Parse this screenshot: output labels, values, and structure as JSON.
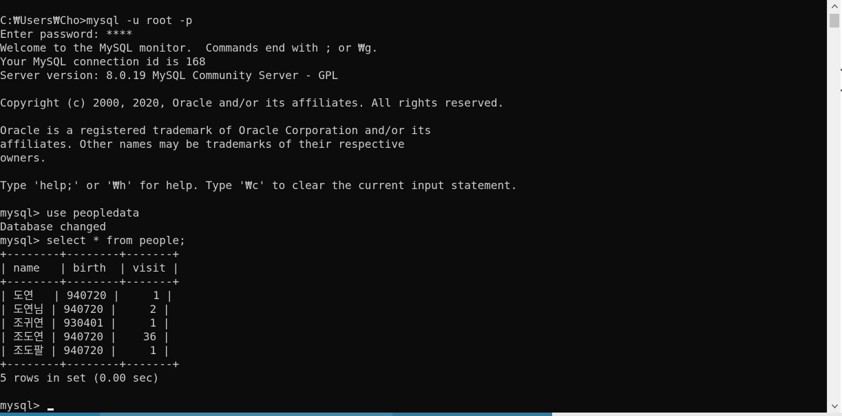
{
  "terminal": {
    "lines": [
      "C:₩Users₩Cho>mysql -u root -p",
      "Enter password: ****",
      "Welcome to the MySQL monitor.  Commands end with ; or ₩g.",
      "Your MySQL connection id is 168",
      "Server version: 8.0.19 MySQL Community Server - GPL",
      "",
      "Copyright (c) 2000, 2020, Oracle and/or its affiliates. All rights reserved.",
      "",
      "Oracle is a registered trademark of Oracle Corporation and/or its",
      "affiliates. Other names may be trademarks of their respective",
      "owners.",
      "",
      "Type 'help;' or '₩h' for help. Type '₩c' to clear the current input statement.",
      "",
      "mysql> use peopledata",
      "Database changed",
      "mysql> select * from people;",
      "+--------+--------+-------+",
      "| name   | birth  | visit |",
      "+--------+--------+-------+",
      "| 도연   | 940720 |     1 |",
      "| 도연님 | 940720 |     2 |",
      "| 조귀연 | 930401 |     1 |",
      "| 조도연 | 940720 |    36 |",
      "| 조도팔 | 940720 |     1 |",
      "+--------+--------+-------+",
      "5 rows in set (0.00 sec)",
      ""
    ],
    "prompt": "mysql> "
  },
  "colors": {
    "background": "#0c0c0c",
    "text": "#cccccc",
    "cursor": "#ffffff",
    "scrollbar_track": "#f0f0f0",
    "scrollbar_thumb": "#c1c1c1",
    "taskbar_accent": "#1e7fa8"
  },
  "icons": {
    "scroll_up": "chevron-up-icon",
    "scroll_down": "chevron-down-icon"
  }
}
